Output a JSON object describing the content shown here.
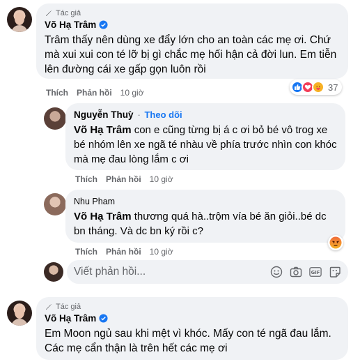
{
  "colors": {
    "bubble": "#f0f2f5",
    "secondary_text": "#65676b",
    "link": "#1877f2",
    "text": "#050505"
  },
  "comment1": {
    "author_tag": "Tác giả",
    "author": "Võ Hạ Trâm",
    "text": "Trâm thấy nên dùng xe đẩy lớn cho an toàn các mẹ ơi. Chứ mà xui xui con té lỡ bị gì chắc mẹ hối hận cả đời lun. Em tiễn lên đường cái xe gấp gọn luôn rồi",
    "actions": {
      "like": "Thích",
      "reply": "Phản hồi",
      "time": "10 giờ"
    },
    "reactions": {
      "icons": [
        "like-icon",
        "love-icon",
        "care-icon"
      ],
      "count": "37"
    }
  },
  "reply1": {
    "author": "Nguyễn Thuỳ",
    "separator": "·",
    "follow_label": "Theo dõi",
    "mention": "Võ Hạ Trâm",
    "text": " con e cũng từng bị á c ơi bỏ bé vô trog xe bé nhóm lên xe ngã té nhàu về phía trước nhìn con khóc mà mẹ đau lòng lắm c ơi",
    "actions": {
      "like": "Thích",
      "reply": "Phản hồi",
      "time": "10 giờ"
    }
  },
  "reply2": {
    "author": "Nhu Pham",
    "mention": "Võ Hạ Trâm",
    "text": " thương quá hà..trộm vía bé ăn giỏi..bé dc bn tháng. Và dc bn ký rồi c?",
    "actions": {
      "like": "Thích",
      "reply": "Phản hồi",
      "time": "10 giờ"
    },
    "reaction_icon": "angry-icon"
  },
  "reply_input": {
    "placeholder": "Viết phản hồi..."
  },
  "comment2": {
    "author_tag": "Tác giả",
    "author": "Võ Hạ Trâm",
    "text": "Em Moon ngủ sau khi mệt vì khóc. Mấy con té ngã đau lắm. Các mẹ cẩn thận là trên hết các mẹ ơi"
  }
}
